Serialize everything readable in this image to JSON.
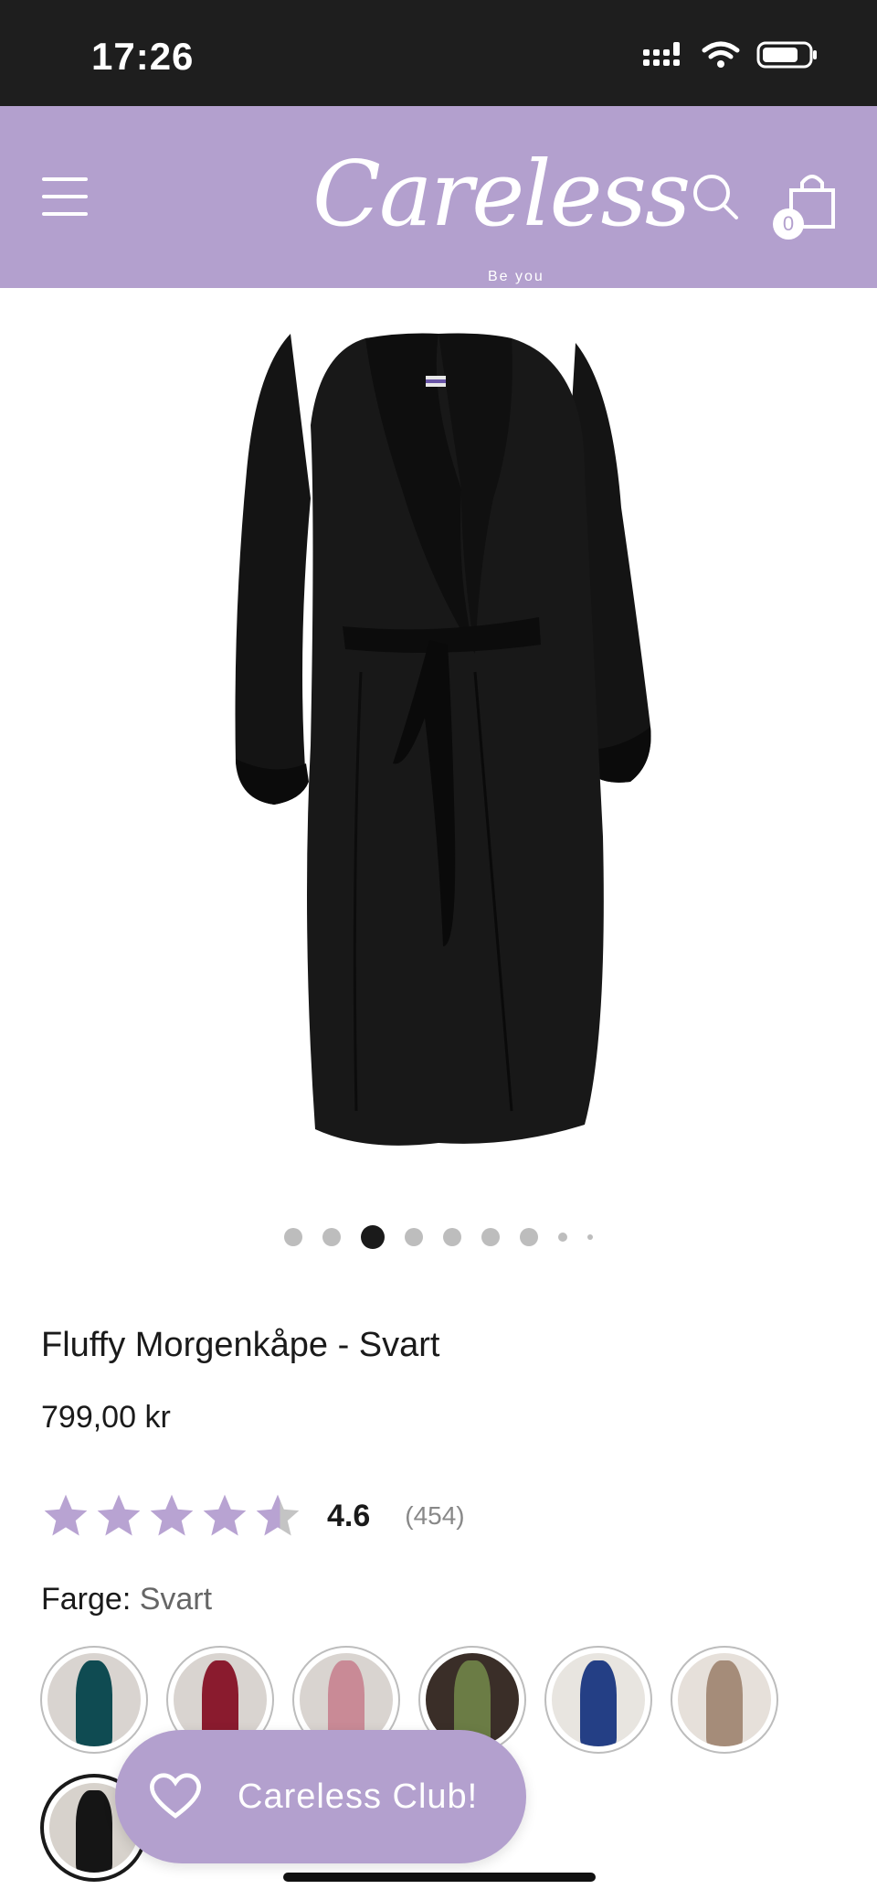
{
  "status_bar": {
    "time": "17:26",
    "icons": [
      "signal-icon",
      "wifi-icon",
      "battery-icon"
    ]
  },
  "header": {
    "logo_text": "Careless",
    "logo_tagline": "Be you",
    "cart_count": "0",
    "icons": [
      "menu-icon",
      "search-icon",
      "shopping-bag-icon"
    ],
    "colors": {
      "header_bg": "#b3a0ce",
      "accent": "#b3a0ce"
    }
  },
  "product": {
    "title": "Fluffy Morgenkåpe - Svart",
    "price": "799,00 kr",
    "rating": {
      "value": "4.6",
      "count": "(454)",
      "stars_filled_fraction": 0.92
    },
    "color_label": "Farge:",
    "color_value": "Svart",
    "image_carousel": {
      "total_dots": 9,
      "active_index": 2
    }
  },
  "swatches": [
    {
      "name": "Teal",
      "color": "#0f4b52"
    },
    {
      "name": "Red",
      "color": "#8a1b2e"
    },
    {
      "name": "Pink",
      "color": "#c98a96"
    },
    {
      "name": "Green",
      "color": "#6b7c45"
    },
    {
      "name": "Blue",
      "color": "#243f85"
    },
    {
      "name": "Taupe",
      "color": "#a58c79"
    },
    {
      "name": "Black",
      "color": "#151515",
      "selected": true
    }
  ],
  "club_button": {
    "label": "Careless Club!"
  }
}
